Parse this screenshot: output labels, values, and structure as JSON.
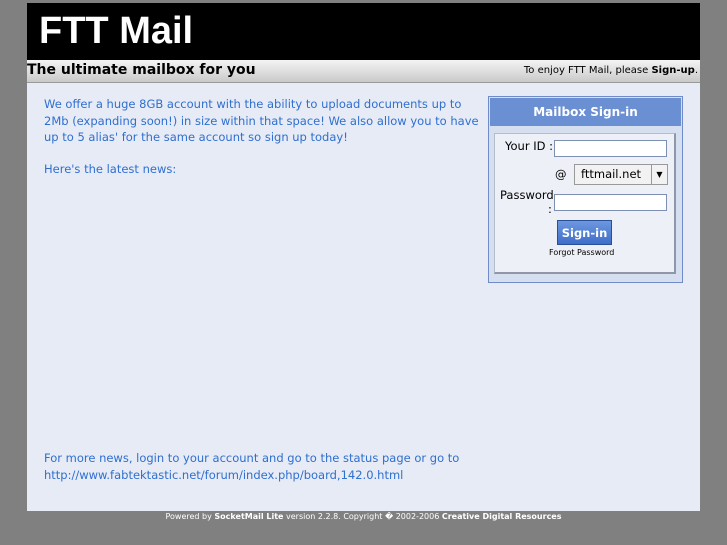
{
  "header": {
    "title": "FTT Mail"
  },
  "subbar": {
    "tagline": "The ultimate mailbox for you",
    "signup_prefix": "To enjoy FTT Mail, please ",
    "signup_link": "Sign-up",
    "signup_suffix": "."
  },
  "main": {
    "intro": "We offer a huge 8GB account with the ability to upload documents up to 2Mb (expanding soon!) in size within that space! We also allow you to have up to 5 alias' for the same account so sign up today!",
    "news_label": "Here's the latest news:",
    "more_news_text": "For more news, login to your account and go to the status page or go to",
    "more_news_link": "http://www.fabtektastic.net/forum/index.php/board,142.0.html"
  },
  "signin": {
    "heading": "Mailbox Sign-in",
    "id_label": "Your ID :",
    "at_label": "@",
    "domain_value": "fttmail.net",
    "password_label_1": "Password",
    "password_label_2": ":",
    "id_value": "",
    "password_value": "",
    "button_label": "Sign-in",
    "forgot_label": "Forgot Password"
  },
  "footer": {
    "powered_prefix": "Powered by ",
    "product": "SocketMail Lite",
    "version_text": " version 2.2.8. Copyright � 2002-2006 ",
    "company": "Creative Digital Resources"
  }
}
